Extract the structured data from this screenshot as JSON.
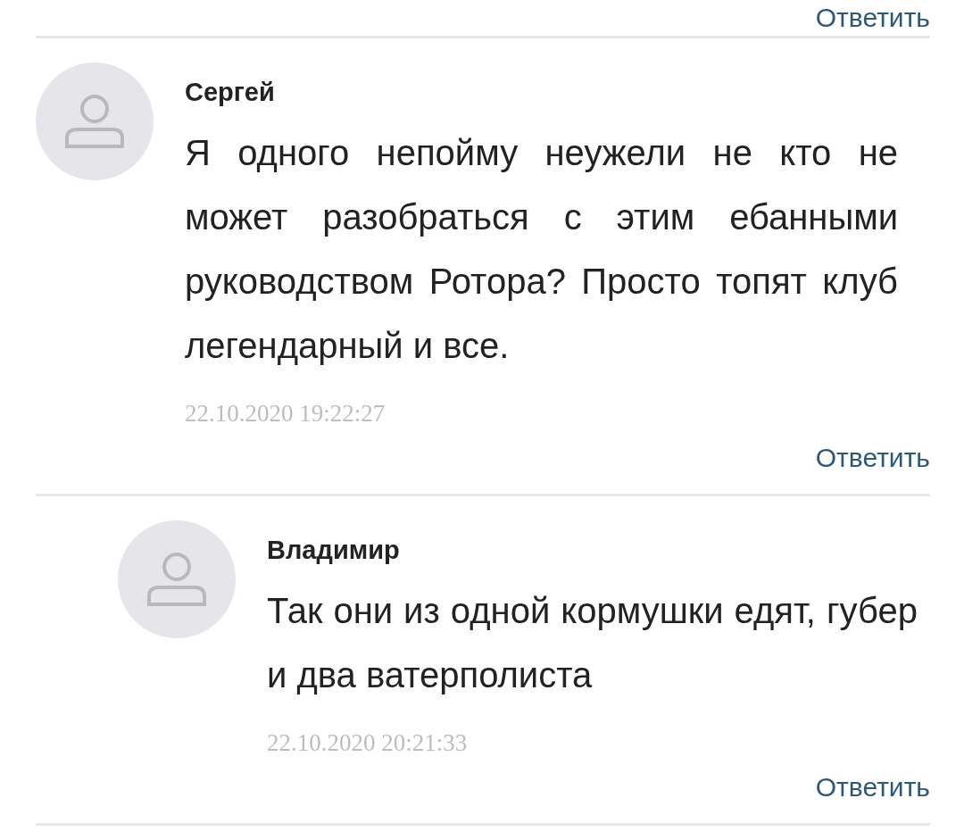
{
  "top_reply_link": "Ответить",
  "comments": [
    {
      "author": "Сергей",
      "text": "Я одного непойму неужели не кто не может разобраться с этим ебанными руководством Ротора? Просто топят клуб легендарный и все.",
      "date": "22.10.2020 19:22:27",
      "reply_label": "Ответить",
      "children": [
        {
          "author": "Владимир",
          "text": "Так они из одной кормушки едят, губер и два ватерполиста",
          "date": "22.10.2020 20:21:33",
          "reply_label": "Ответить"
        }
      ]
    }
  ]
}
